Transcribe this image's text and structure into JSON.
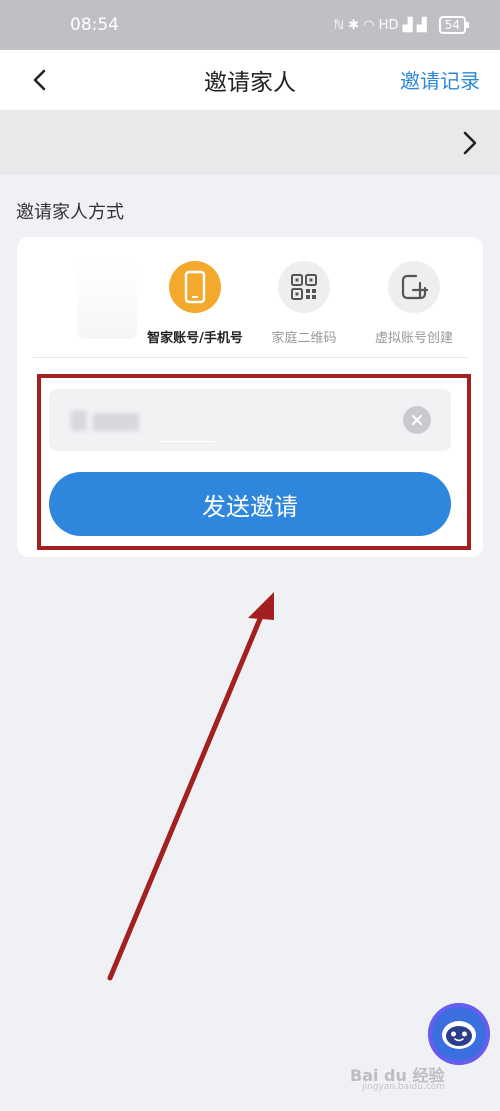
{
  "status_bar": {
    "time": "08:54",
    "signal_icons": "ℕ ✱ ◠ HD ▟ ▟",
    "battery": "54"
  },
  "nav": {
    "back_icon": "chevron-left-icon",
    "title": "邀请家人",
    "right_link": "邀请记录"
  },
  "band": {
    "chevron_icon": "chevron-right-icon"
  },
  "section": {
    "title": "邀请家人方式"
  },
  "options": [
    {
      "label": "智家账号/手机号",
      "icon": "phone-icon",
      "active": true
    },
    {
      "label": "家庭二维码",
      "icon": "qr-code-icon",
      "active": false
    },
    {
      "label": "虚拟账号创建",
      "icon": "add-square-icon",
      "active": false
    }
  ],
  "input": {
    "value": "▇  ▆▆▆"
  },
  "send_button": {
    "label": "发送邀请"
  },
  "colors": {
    "accent": "#2e87dd",
    "active_option": "#f3a92c",
    "annotation": "#a32020"
  },
  "watermark": {
    "brand": "Bai du 经验",
    "sub": "jingyan.baidu.com"
  }
}
